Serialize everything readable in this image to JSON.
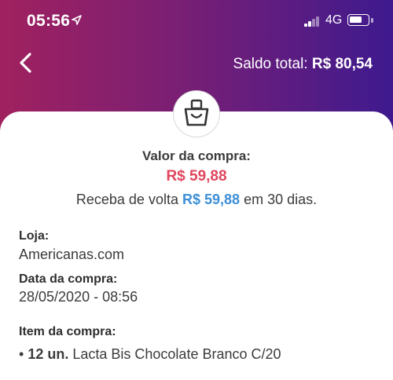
{
  "status_bar": {
    "time": "05:56",
    "network": "4G",
    "icons": [
      "location-arrow-icon",
      "signal-icon",
      "battery-icon"
    ]
  },
  "nav": {
    "back_icon": "chevron-left-icon",
    "saldo_label": "Saldo total:",
    "saldo_value": "R$ 80,54"
  },
  "purchase": {
    "icon": "shopping-bag-icon",
    "valor_label": "Valor da compra:",
    "valor_amount": "R$ 59,88",
    "cashback_prefix": "Receba de volta",
    "cashback_amount": "R$ 59,88",
    "cashback_suffix": "em 30 dias."
  },
  "details": {
    "loja_label": "Loja:",
    "loja_value": "Americanas.com",
    "data_label": "Data da compra:",
    "data_value": "28/05/2020 - 08:56",
    "item_label": "Item da compra:",
    "items": [
      {
        "bullet": "•",
        "qty": "12 un.",
        "name": "Lacta Bis Chocolate Branco C/20"
      }
    ]
  },
  "colors": {
    "header_gradient_start": "#a0215f",
    "header_gradient_end": "#3e1a8e",
    "price_red": "#e0455d",
    "cashback_blue": "#3d8fd6"
  }
}
